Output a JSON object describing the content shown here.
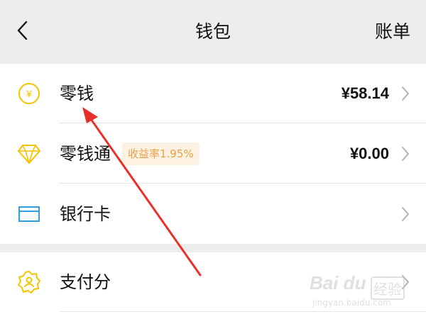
{
  "header": {
    "title": "钱包",
    "bill_label": "账单"
  },
  "wallet_list": [
    {
      "label": "零钱",
      "value": "¥58.14",
      "icon": "yuan-coin-icon"
    },
    {
      "label": "零钱通",
      "badge": "收益率1.95%",
      "value": "¥0.00",
      "icon": "diamond-icon"
    },
    {
      "label": "银行卡",
      "value": "",
      "icon": "bank-card-icon"
    }
  ],
  "services_list": [
    {
      "label": "支付分",
      "icon": "pay-score-icon"
    }
  ],
  "watermark": {
    "logo": "Bai du",
    "brand": "经验",
    "url": "jingyan.baidu.com"
  },
  "colors": {
    "accent_yellow": "#f5c400",
    "card_blue": "#2f9ee6",
    "badge_text": "#e8a04a",
    "badge_bg": "#fdf1e1",
    "annotation_arrow": "#e8302a"
  }
}
